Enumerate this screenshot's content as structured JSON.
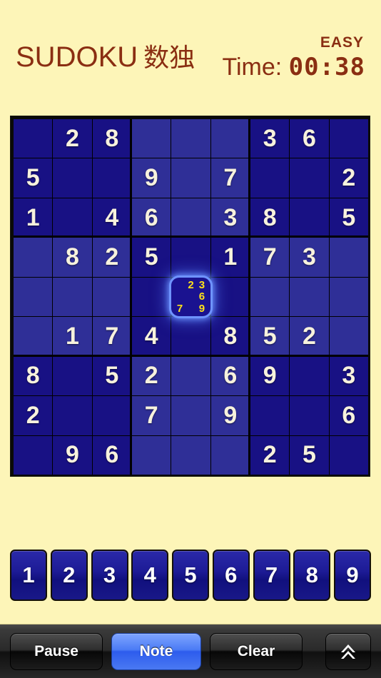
{
  "header": {
    "title_main": "SUDOKU",
    "title_jp": "数独",
    "difficulty": "EASY",
    "timer_label": "Time: ",
    "timer_value": "00:38"
  },
  "board": {
    "rows": [
      [
        "",
        "2",
        "8",
        "",
        "",
        "",
        "3",
        "6",
        ""
      ],
      [
        "5",
        "",
        "",
        "9",
        "",
        "7",
        "",
        "",
        "2"
      ],
      [
        "1",
        "",
        "4",
        "6",
        "",
        "3",
        "8",
        "",
        "5"
      ],
      [
        "",
        "8",
        "2",
        "5",
        "",
        "1",
        "7",
        "3",
        ""
      ],
      [
        "",
        "",
        "",
        "",
        "",
        "",
        "",
        "",
        ""
      ],
      [
        "",
        "1",
        "7",
        "4",
        "",
        "8",
        "5",
        "2",
        ""
      ],
      [
        "8",
        "",
        "5",
        "2",
        "",
        "6",
        "9",
        "",
        "3"
      ],
      [
        "2",
        "",
        "",
        "7",
        "",
        "9",
        "",
        "",
        "6"
      ],
      [
        "",
        "9",
        "6",
        "",
        "",
        "",
        "2",
        "5",
        ""
      ]
    ],
    "selected": {
      "row": 4,
      "col": 4
    },
    "selected_notes": [
      "",
      "2",
      "3",
      "",
      "",
      "6",
      "7",
      "",
      "9"
    ],
    "colors": {
      "box_dark": "#181184",
      "box_light": "#2f2f97",
      "digit": "#f7f2dd",
      "note": "#ffe11a",
      "selection_glow": "#6f93ff",
      "page_background": "#fdf5b8",
      "title": "#8a2e12"
    }
  },
  "numpad": {
    "buttons": [
      "1",
      "2",
      "3",
      "4",
      "5",
      "6",
      "7",
      "8",
      "9"
    ]
  },
  "toolbar": {
    "pause_label": "Pause",
    "note_label": "Note",
    "clear_label": "Clear",
    "up_icon": "double-chevron-up-icon",
    "note_active": true
  }
}
